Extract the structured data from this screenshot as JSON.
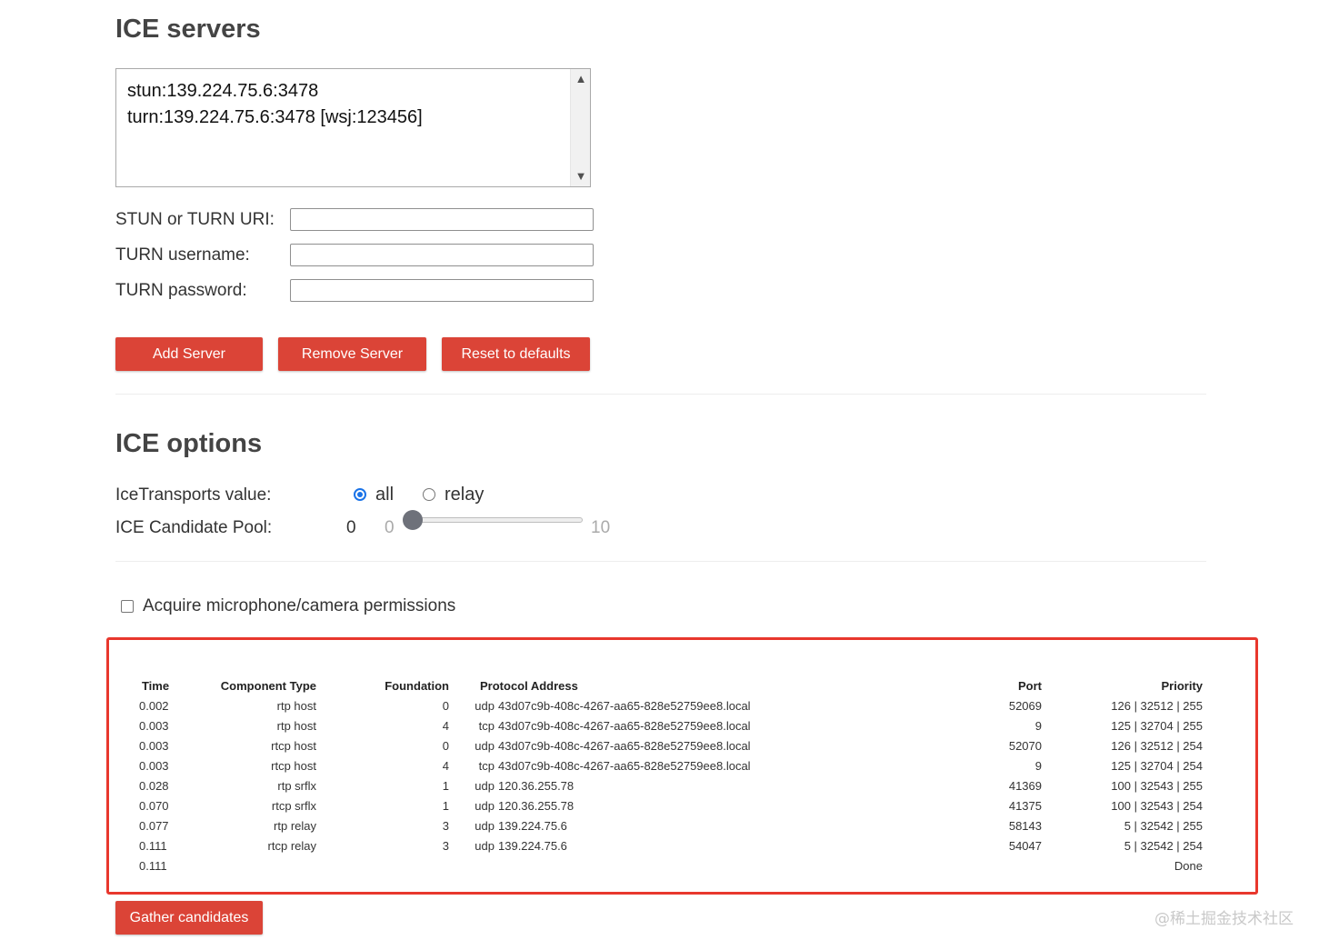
{
  "ice_servers": {
    "title": "ICE servers",
    "list": [
      "stun:139.224.75.6:3478",
      "turn:139.224.75.6:3478 [wsj:123456]"
    ],
    "uri_label": "STUN or TURN URI:",
    "uri_value": "",
    "username_label": "TURN username:",
    "username_value": "",
    "password_label": "TURN password:",
    "password_value": "",
    "add_button": "Add Server",
    "remove_button": "Remove Server",
    "reset_button": "Reset to defaults"
  },
  "ice_options": {
    "title": "ICE options",
    "transports_label": "IceTransports value:",
    "transport_all": "all",
    "transport_relay": "relay",
    "transport_selected": "all",
    "pool_label": "ICE Candidate Pool:",
    "pool_value": "0",
    "pool_min": "0",
    "pool_max": "10"
  },
  "permissions": {
    "label": "Acquire microphone/camera permissions",
    "checked": false
  },
  "candidates": {
    "headers": [
      "Time",
      "Component Type",
      "Foundation",
      "Protocol Address",
      "Port",
      "Priority"
    ],
    "rows": [
      {
        "time": "0.002",
        "component": "rtp host",
        "foundation": "0",
        "protocol": "udp",
        "address": "43d07c9b-408c-4267-aa65-828e52759ee8.local",
        "port": "52069",
        "priority": "126 | 32512 | 255"
      },
      {
        "time": "0.003",
        "component": "rtp host",
        "foundation": "4",
        "protocol": "tcp",
        "address": "43d07c9b-408c-4267-aa65-828e52759ee8.local",
        "port": "9",
        "priority": "125 | 32704 | 255"
      },
      {
        "time": "0.003",
        "component": "rtcp host",
        "foundation": "0",
        "protocol": "udp",
        "address": "43d07c9b-408c-4267-aa65-828e52759ee8.local",
        "port": "52070",
        "priority": "126 | 32512 | 254"
      },
      {
        "time": "0.003",
        "component": "rtcp host",
        "foundation": "4",
        "protocol": "tcp",
        "address": "43d07c9b-408c-4267-aa65-828e52759ee8.local",
        "port": "9",
        "priority": "125 | 32704 | 254"
      },
      {
        "time": "0.028",
        "component": "rtp srflx",
        "foundation": "1",
        "protocol": "udp",
        "address": "120.36.255.78",
        "port": "41369",
        "priority": "100 | 32543 | 255"
      },
      {
        "time": "0.070",
        "component": "rtcp srflx",
        "foundation": "1",
        "protocol": "udp",
        "address": "120.36.255.78",
        "port": "41375",
        "priority": "100 | 32543 | 254"
      },
      {
        "time": "0.077",
        "component": "rtp relay",
        "foundation": "3",
        "protocol": "udp",
        "address": "139.224.75.6",
        "port": "58143",
        "priority": "5 | 32542 | 255"
      },
      {
        "time": "0.111",
        "component": "rtcp relay",
        "foundation": "3",
        "protocol": "udp",
        "address": "139.224.75.6",
        "port": "54047",
        "priority": "5 | 32542 | 254"
      }
    ],
    "final_time": "0.111",
    "final_status": "Done"
  },
  "gather_button": "Gather candidates",
  "watermark": "@稀土掘金技术社区",
  "colors": {
    "button_red": "#db4437",
    "highlight_red": "#e8372d",
    "radio_blue": "#1a73e8"
  }
}
